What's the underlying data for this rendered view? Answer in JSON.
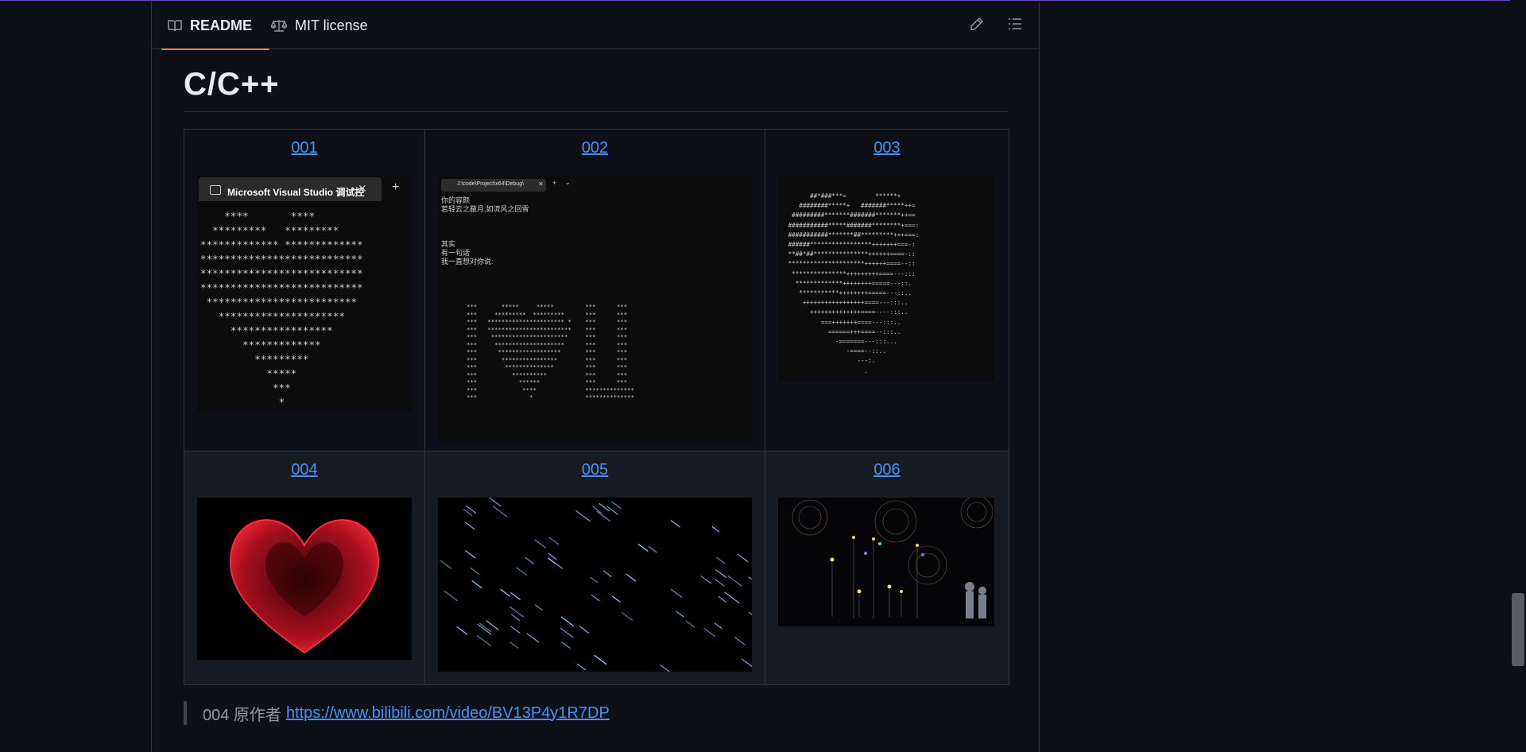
{
  "tabs": {
    "readme": "README",
    "license": "MIT license"
  },
  "toolbar": {
    "edit_icon": "pencil-icon",
    "toc_icon": "list-icon"
  },
  "heading": "C/C++",
  "gallery": {
    "row1": [
      {
        "label": "001"
      },
      {
        "label": "002"
      },
      {
        "label": "003"
      }
    ],
    "row2": [
      {
        "label": "004"
      },
      {
        "label": "005"
      },
      {
        "label": "006"
      }
    ]
  },
  "shot001": {
    "tab_title": "Microsoft Visual Studio 调试控",
    "close": "✕",
    "add": "+"
  },
  "shot002": {
    "tab_title": "J:\\code\\Project\\x64\\Debug\\",
    "close": "✕",
    "add": "+",
    "chevron": "⌄",
    "lines": [
      "你的容颜",
      "若轻云之蔽月,如流风之回雪",
      "",
      "",
      "其实",
      "有一句话",
      "我一直想对你说:"
    ]
  },
  "quote": {
    "prefix": "004 原作者",
    "link": "https://www.bilibili.com/video/BV13P4y1R7DP"
  },
  "colors": {
    "background": "#0d1117",
    "link": "#4493f8",
    "tab_underline": "#f78166",
    "border": "#30363d"
  }
}
